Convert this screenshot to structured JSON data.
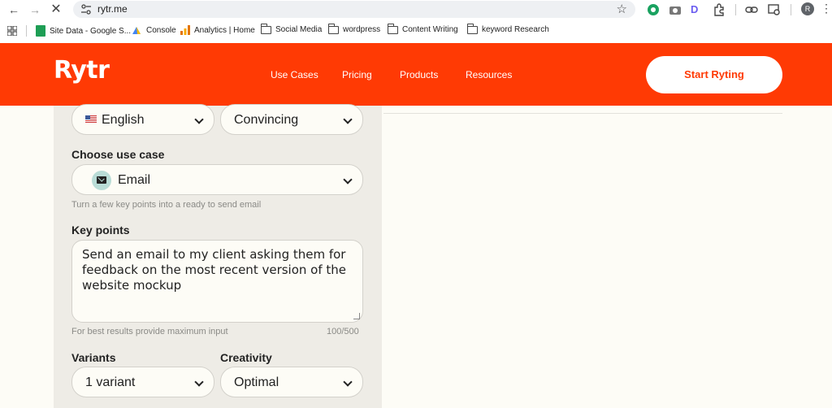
{
  "browser": {
    "url": "rytr.me",
    "avatar_initial": "R",
    "bookmarks": [
      {
        "label": "Site Data - Google S...",
        "icon": "google-sheets-icon"
      },
      {
        "label": "Console",
        "icon": "search-console-icon"
      },
      {
        "label": "Analytics | Home",
        "icon": "analytics-icon"
      },
      {
        "label": "Social Media",
        "icon": "folder-icon"
      },
      {
        "label": "wordpress",
        "icon": "folder-icon"
      },
      {
        "label": "Content Writing",
        "icon": "folder-icon"
      },
      {
        "label": "keyword Research",
        "icon": "folder-icon"
      }
    ]
  },
  "header": {
    "logo": "Rytr",
    "nav": [
      "Use Cases",
      "Pricing",
      "Products",
      "Resources"
    ],
    "cta": "Start Ryting",
    "brand_color": "#ff3a04"
  },
  "form": {
    "language": "English",
    "tone": "Convincing",
    "use_case_label": "Choose use case",
    "use_case": "Email",
    "use_case_hint": "Turn a few key points into a ready to send email",
    "key_points_label": "Key points",
    "key_points": "Send an email to my client asking them for feedback on the most recent version of the website mockup",
    "input_hint": "For best results provide maximum input",
    "char_count": "100/500",
    "variants_label": "Variants",
    "variants": "1 variant",
    "creativity_label": "Creativity",
    "creativity": "Optimal"
  }
}
